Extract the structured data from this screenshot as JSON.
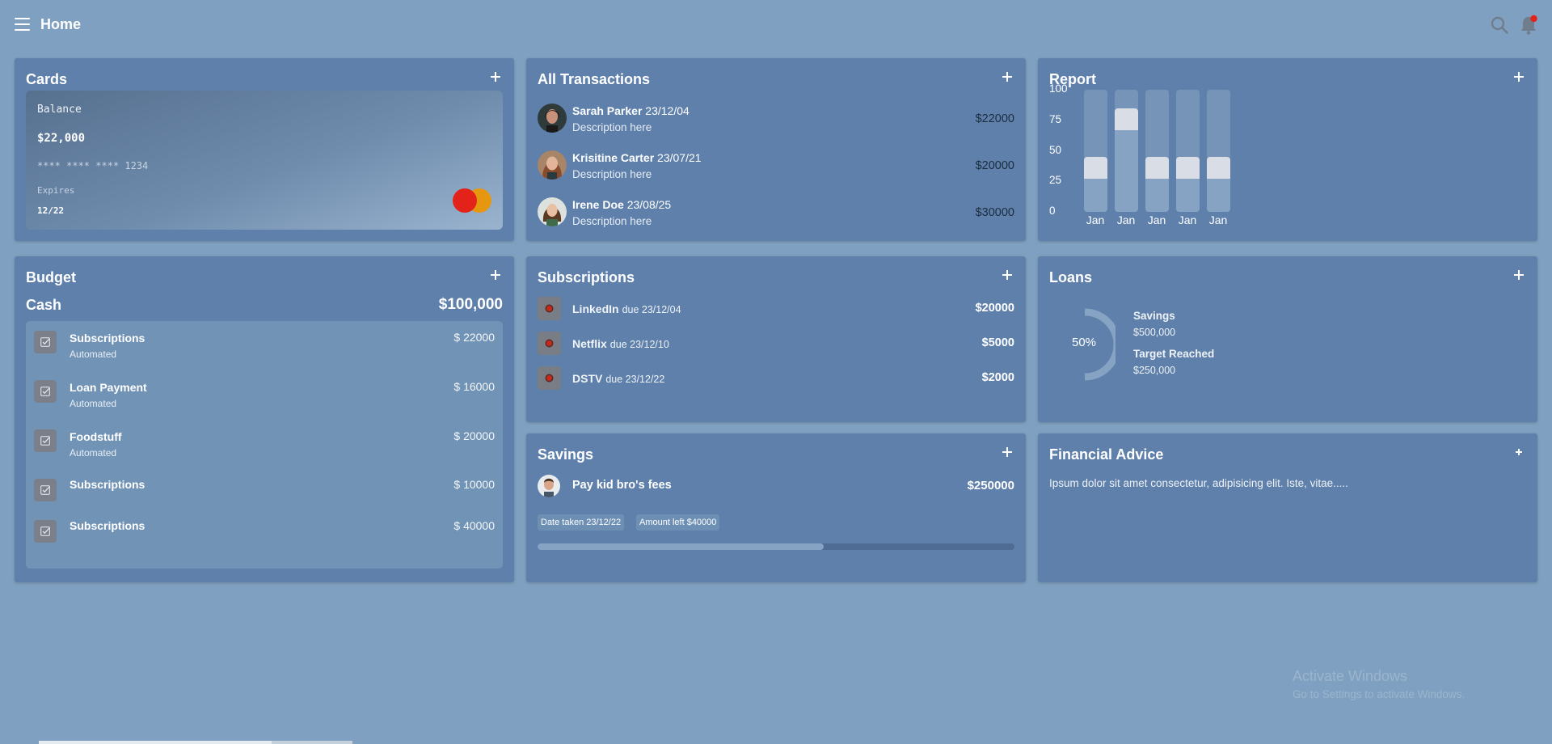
{
  "header": {
    "title": "Home"
  },
  "cards": {
    "title": "Cards",
    "balance_label": "Balance",
    "balance": "$22,000",
    "number": "**** **** **** 1234",
    "expires_label": "Expires",
    "expires": "12/22"
  },
  "transactions": {
    "title": "All Transactions",
    "items": [
      {
        "name": "Sarah Parker",
        "date": "23/12/04",
        "description": "Description here",
        "amount": "$22000"
      },
      {
        "name": "Krisitine Carter",
        "date": "23/07/21",
        "description": "Description here",
        "amount": "$20000"
      },
      {
        "name": "Irene Doe",
        "date": "23/08/25",
        "description": "Description here",
        "amount": "$30000"
      }
    ]
  },
  "report": {
    "title": "Report",
    "chart_data": {
      "type": "bar",
      "categories": [
        "Jan",
        "Jan",
        "Jan",
        "Jan",
        "Jan"
      ],
      "values": [
        45,
        85,
        45,
        45,
        45
      ],
      "yticks": [
        "100",
        "75",
        "50",
        "25",
        "0"
      ],
      "ylim": [
        0,
        100
      ]
    }
  },
  "budget": {
    "title": "Budget",
    "cash_label": "Cash",
    "cash_value": "$100,000",
    "items": [
      {
        "title": "Subscriptions",
        "sub": "Automated",
        "amount": "$ 22000"
      },
      {
        "title": "Loan Payment",
        "sub": "Automated",
        "amount": "$ 16000"
      },
      {
        "title": "Foodstuff",
        "sub": "Automated",
        "amount": "$ 20000"
      },
      {
        "title": "Subscriptions",
        "sub": "",
        "amount": "$ 10000"
      },
      {
        "title": "Subscriptions",
        "sub": "",
        "amount": "$ 40000"
      }
    ]
  },
  "subscriptions": {
    "title": "Subscriptions",
    "items": [
      {
        "name": "LinkedIn",
        "due": "due 23/12/04",
        "amount": "$20000"
      },
      {
        "name": "Netflix",
        "due": "due 23/12/10",
        "amount": "$5000"
      },
      {
        "name": "DSTV",
        "due": "due 23/12/22",
        "amount": "$2000"
      }
    ]
  },
  "loans": {
    "title": "Loans",
    "percent": "50%",
    "savings_label": "Savings",
    "savings_value": "$500,000",
    "target_label": "Target Reached",
    "target_value": "$250,000"
  },
  "savings": {
    "title": "Savings",
    "goal": "Pay kid bro's fees",
    "amount": "$250000",
    "date_taken": "Date taken 23/12/22",
    "amount_left": "Amount left $40000",
    "progress": 0.6
  },
  "advice": {
    "title": "Financial Advice",
    "text": "Ipsum dolor sit amet consectetur, adipisicing elit. Iste, vitae....."
  },
  "watermark": {
    "title": "Activate Windows",
    "sub": "Go to Settings to activate Windows."
  },
  "colors": {
    "background": "#7fa0c0",
    "panel": "#5e80ab",
    "accent_red": "#e3221a",
    "accent_orange": "#e5970f"
  },
  "icons": [
    "menu-icon",
    "search-icon",
    "bell-icon",
    "plus-icon",
    "check-icon",
    "mastercard-logo"
  ]
}
